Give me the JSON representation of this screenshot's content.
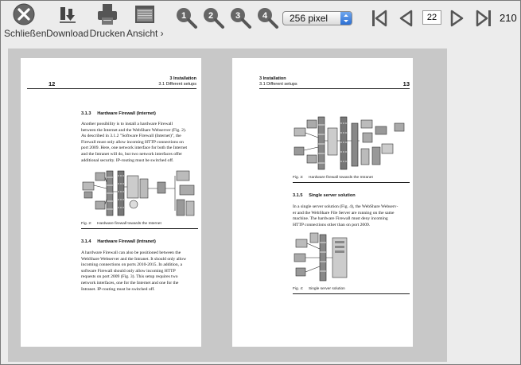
{
  "toolbar": {
    "close_label": "Schließen",
    "download_label": "Download",
    "print_label": "Drucken",
    "view_label": "Ansicht ›",
    "zoom_levels": [
      "1",
      "2",
      "3",
      "4"
    ],
    "zoom_select_value": "256 pixel",
    "current_page": "22",
    "total_pages": "210"
  },
  "left_page": {
    "chapter": "3 Installation",
    "subchapter": "3.1 Different setups",
    "page_number": "12",
    "section1_title": "3.1.3     Hardware Firewall (Internet)",
    "section1_lines": [
      "Another possibility is to install a hardware Firewall",
      "between the Internet and the WebShare Webserver (Fig. 2).",
      "As described in 3.1.2 \"Software Firewall (Internet)\", the",
      "Firewall must only allow incoming HTTP connections on",
      "port 2009. Here, one network interface for both the Internet",
      "and the Intranet will do, but two network interfaces offer",
      "additional security. IP-routing must be switched off."
    ],
    "fig2_caption": "Fig. 2:     Hardware firewall towards the Internet",
    "section2_title": "3.1.4     Hardware Firewall (Intranet)",
    "section2_lines": [
      "A hardware Firewall can also be positioned between the",
      "WebShare Webserver and the Intranet. It should only allow",
      "incoming connections on ports 2010-2015. In addition, a",
      "software Firewall should only allow incoming HTTP",
      "requests on port 2009 (Fig. 3). This setup requires two",
      "network interfaces, one for the Internet and one for the",
      "Intranet. IP-routing must be switched off."
    ]
  },
  "right_page": {
    "chapter": "3 Installation",
    "subchapter": "3.1 Different setups",
    "page_number": "13",
    "fig3_caption": "Fig. 3:     Hardware firewall towards the Intranet",
    "section_title": "3.1.5     Single server solution",
    "section_lines": [
      "In a single server solution (Fig. 4), the WebShare Webserv-",
      "er and the WebShare File Server are running on the same",
      "machine. The hardware Firewall must deny incoming",
      "HTTP connections other than on port 2009."
    ],
    "fig4_caption": "Fig. 4:     Single server solution"
  }
}
